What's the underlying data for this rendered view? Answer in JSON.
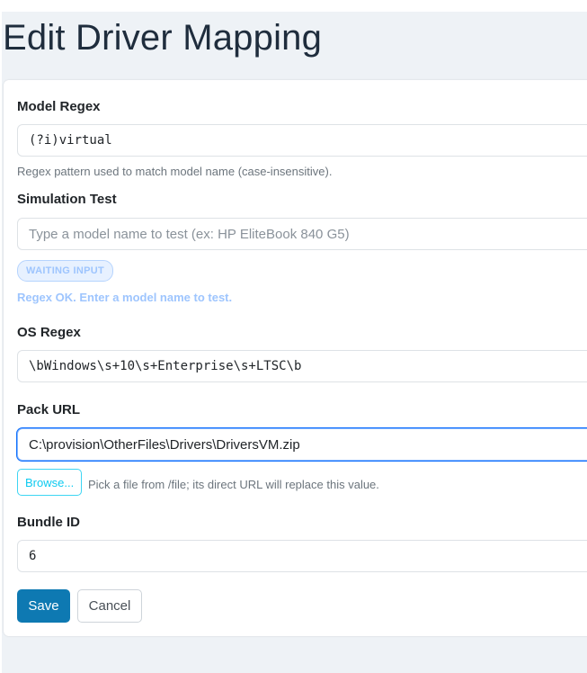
{
  "page": {
    "title": "Edit Driver Mapping"
  },
  "form": {
    "model_regex": {
      "label": "Model Regex",
      "value": "(?i)virtual",
      "help": "Regex pattern used to match model name (case-insensitive)."
    },
    "simulation_test": {
      "label": "Simulation Test",
      "value": "",
      "placeholder": "Type a model name to test (ex: HP EliteBook 840 G5)",
      "badge": "WAITING INPUT",
      "status": "Regex OK. Enter a model name to test."
    },
    "os_regex": {
      "label": "OS Regex",
      "value": "\\bWindows\\s+10\\s+Enterprise\\s+LTSC\\b"
    },
    "pack_url": {
      "label": "Pack URL",
      "value": "C:\\provision\\OtherFiles\\Drivers\\DriversVM.zip",
      "browse_label": "Browse...",
      "help": "Pick a file from /file; its direct URL will replace this value."
    },
    "bundle_id": {
      "label": "Bundle ID",
      "value": "6"
    }
  },
  "actions": {
    "save": "Save",
    "cancel": "Cancel"
  },
  "colors": {
    "primary": "#0e79b2",
    "info": "#0dcaf0",
    "focus": "#0d6efd"
  }
}
